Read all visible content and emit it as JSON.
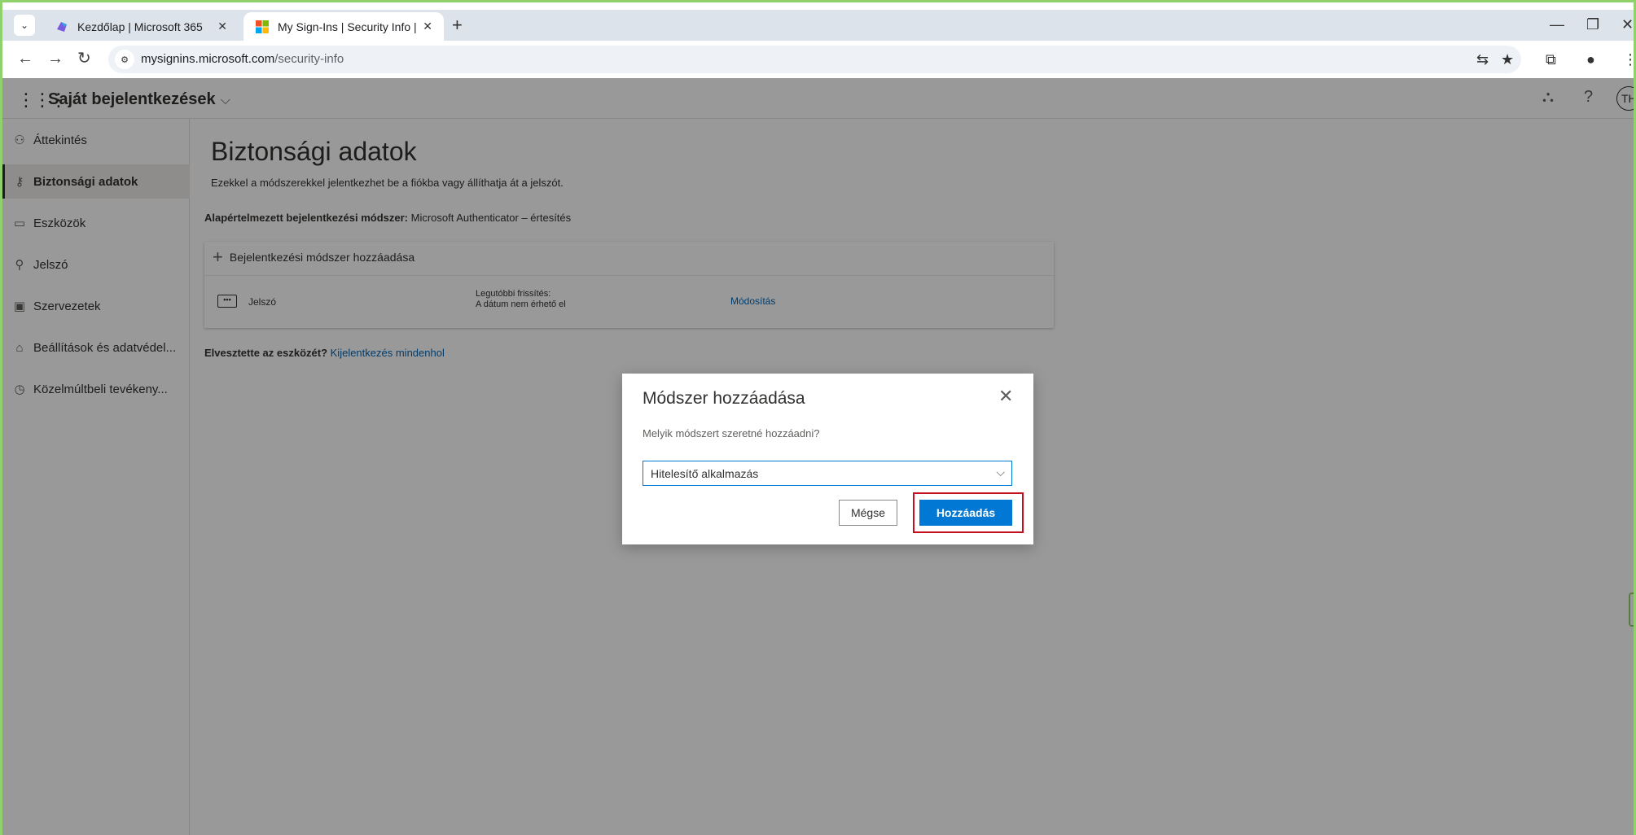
{
  "browser": {
    "tabs": [
      {
        "title": "Kezdőlap | Microsoft 365",
        "active": false
      },
      {
        "title": "My Sign-Ins | Security Info | Mic",
        "active": true
      }
    ],
    "new_tab": "+",
    "url_host": "mysignins.microsoft.com",
    "url_path": "/security-info",
    "window_controls": {
      "minimize": "—",
      "restore": "❐",
      "close": "✕"
    }
  },
  "app": {
    "title": "Saját bejelentkezések",
    "avatar_initials": "TH",
    "help": "?"
  },
  "sidebar": {
    "items": [
      {
        "label": "Áttekintés",
        "icon": "person-icon"
      },
      {
        "label": "Biztonsági adatok",
        "icon": "security-info-icon",
        "selected": true
      },
      {
        "label": "Eszközök",
        "icon": "laptop-icon"
      },
      {
        "label": "Jelszó",
        "icon": "key-icon"
      },
      {
        "label": "Szervezetek",
        "icon": "briefcase-icon"
      },
      {
        "label": "Beállítások és adatvédel...",
        "icon": "lock-icon"
      },
      {
        "label": "Közelmúltbeli tevékeny...",
        "icon": "history-icon"
      }
    ]
  },
  "main": {
    "title": "Biztonsági adatok",
    "subtitle": "Ezekkel a módszerekkel jelentkezhet be a fiókba vagy állíthatja át a jelszót.",
    "default_method_label": "Alapértelmezett bejelentkezési módszer:",
    "default_method_value": "Microsoft Authenticator – értesítés",
    "add_method": "Bejelentkezési módszer hozzáadása",
    "password_row": {
      "icon_text": "•••",
      "label": "Jelszó",
      "updated_label": "Legutóbbi frissítés:",
      "updated_value": "A dátum nem érhető el",
      "action": "Módosítás"
    },
    "lost_device_question": "Elvesztette az eszközét?",
    "lost_device_link": "Kijelentkezés mindenhol"
  },
  "modal": {
    "title": "Módszer hozzáadása",
    "question": "Melyik módszert szeretné hozzáadni?",
    "selected_method": "Hitelesítő alkalmazás",
    "cancel": "Mégse",
    "add": "Hozzáadás",
    "highlight_color": "#c50f1f"
  },
  "colors": {
    "accent": "#0078d4",
    "link": "#0067b8",
    "frame": "#8fd16a"
  }
}
